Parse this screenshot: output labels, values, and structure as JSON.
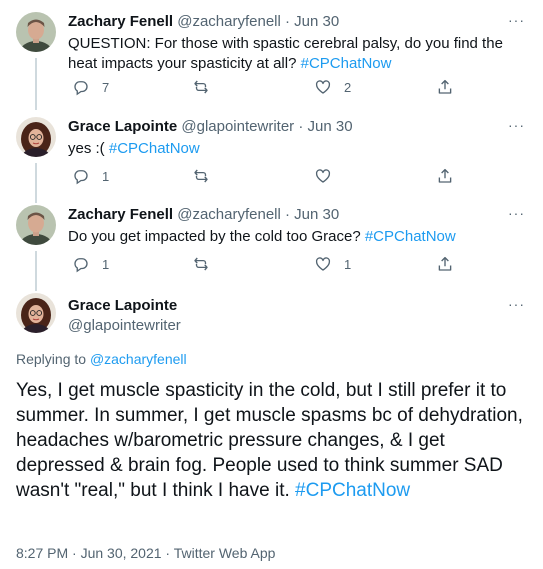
{
  "tweets": [
    {
      "name": "Zachary Fenell",
      "handle": "@zacharyfenell",
      "date": "Jun 30",
      "text": "QUESTION: For those with spastic cerebral palsy, do you find the heat impacts your spasticity at all?",
      "hashtag": "#CPChatNow",
      "reply_count": "7",
      "retweet_count": "",
      "like_count": "2"
    },
    {
      "name": "Grace Lapointe",
      "handle": "@glapointewriter",
      "date": "Jun 30",
      "text": "yes :(",
      "hashtag": "#CPChatNow",
      "reply_count": "1",
      "retweet_count": "",
      "like_count": ""
    },
    {
      "name": "Zachary Fenell",
      "handle": "@zacharyfenell",
      "date": "Jun 30",
      "text": "Do you get impacted by the cold too Grace?",
      "hashtag": "#CPChatNow",
      "reply_count": "1",
      "retweet_count": "",
      "like_count": "1"
    }
  ],
  "main_tweet": {
    "name": "Grace Lapointe",
    "handle": "@glapointewriter",
    "replying_prefix": "Replying to",
    "replying_to": "@zacharyfenell",
    "text": "Yes, I get muscle spasticity in the cold, but I still prefer it to summer. In summer, I get muscle spasms bc of dehydration, headaches w/barometric pressure changes, & I get depressed & brain fog. People used to think summer SAD wasn't \"real,\" but I think I have it.",
    "hashtag": "#CPChatNow",
    "timestamp": "8:27 PM · Jun 30, 2021 · Twitter Web App"
  },
  "separator": "·",
  "more_label": "···",
  "icons": [
    "reply-icon",
    "retweet-icon",
    "like-icon",
    "share-icon",
    "more-icon"
  ],
  "colors": {
    "accent": "#1d9bf0",
    "text": "#0f1419",
    "muted": "#536471",
    "thread_line": "#cfd9de"
  }
}
